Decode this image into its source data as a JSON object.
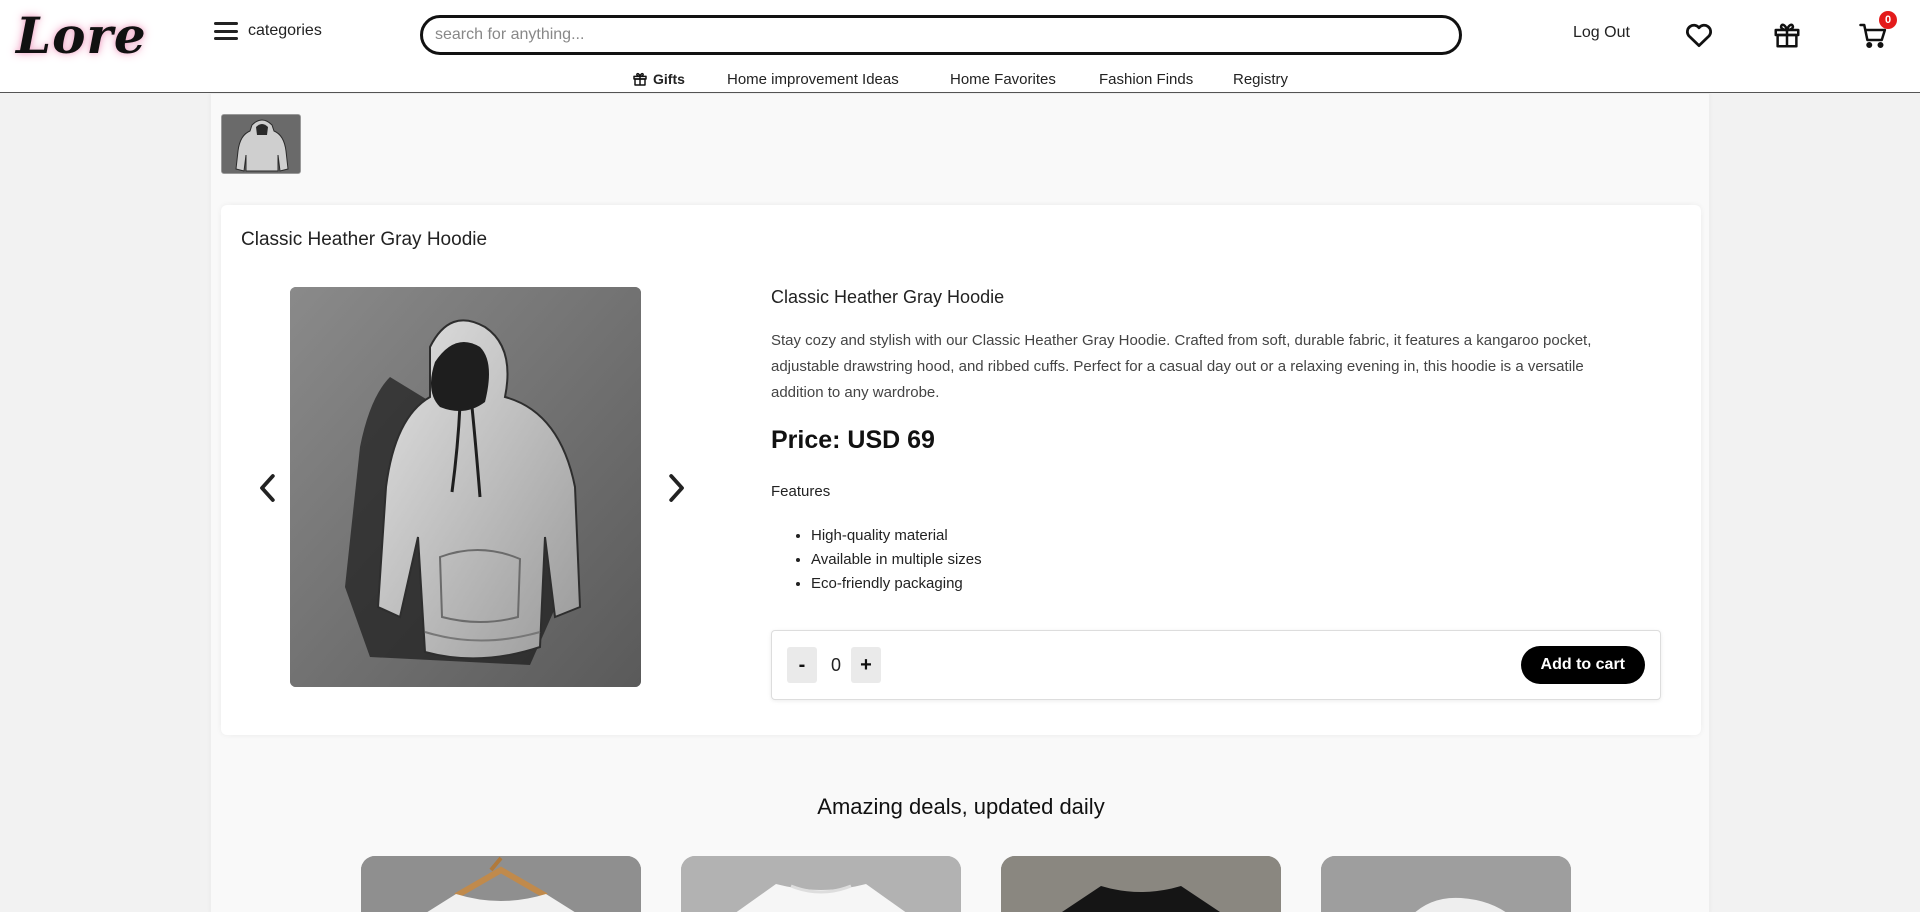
{
  "header": {
    "logo": "Lore",
    "categories_label": "categories",
    "search_placeholder": "search for anything...",
    "logout_label": "Log Out",
    "cart_count": "0"
  },
  "subnav": {
    "items": [
      "Gifts",
      "Home improvement Ideas",
      "Home Favorites",
      "Fashion Finds",
      "Registry"
    ]
  },
  "product": {
    "card_title": "Classic Heather Gray Hoodie",
    "title": "Classic Heather Gray Hoodie",
    "description": "Stay cozy and stylish with our Classic Heather Gray Hoodie. Crafted from soft, durable fabric, it features a kangaroo pocket, adjustable drawstring hood, and ribbed cuffs. Perfect for a casual day out or a relaxing evening in, this hoodie is a versatile addition to any wardrobe.",
    "price": "Price: USD 69",
    "features_title": "Features",
    "features": [
      "High-quality material",
      "Available in multiple sizes",
      "Eco-friendly packaging"
    ],
    "quantity": "0",
    "minus_label": "-",
    "plus_label": "+",
    "add_to_cart_label": "Add to cart"
  },
  "deals": {
    "title": "Amazing deals, updated daily"
  },
  "colors": {
    "badge": "#e31b1b",
    "logo_glow": "#f0a3c4",
    "button": "#000000"
  },
  "icons": [
    "menu-icon",
    "heart-icon",
    "gift-icon",
    "cart-icon",
    "chevron-left-icon",
    "chevron-right-icon"
  ]
}
